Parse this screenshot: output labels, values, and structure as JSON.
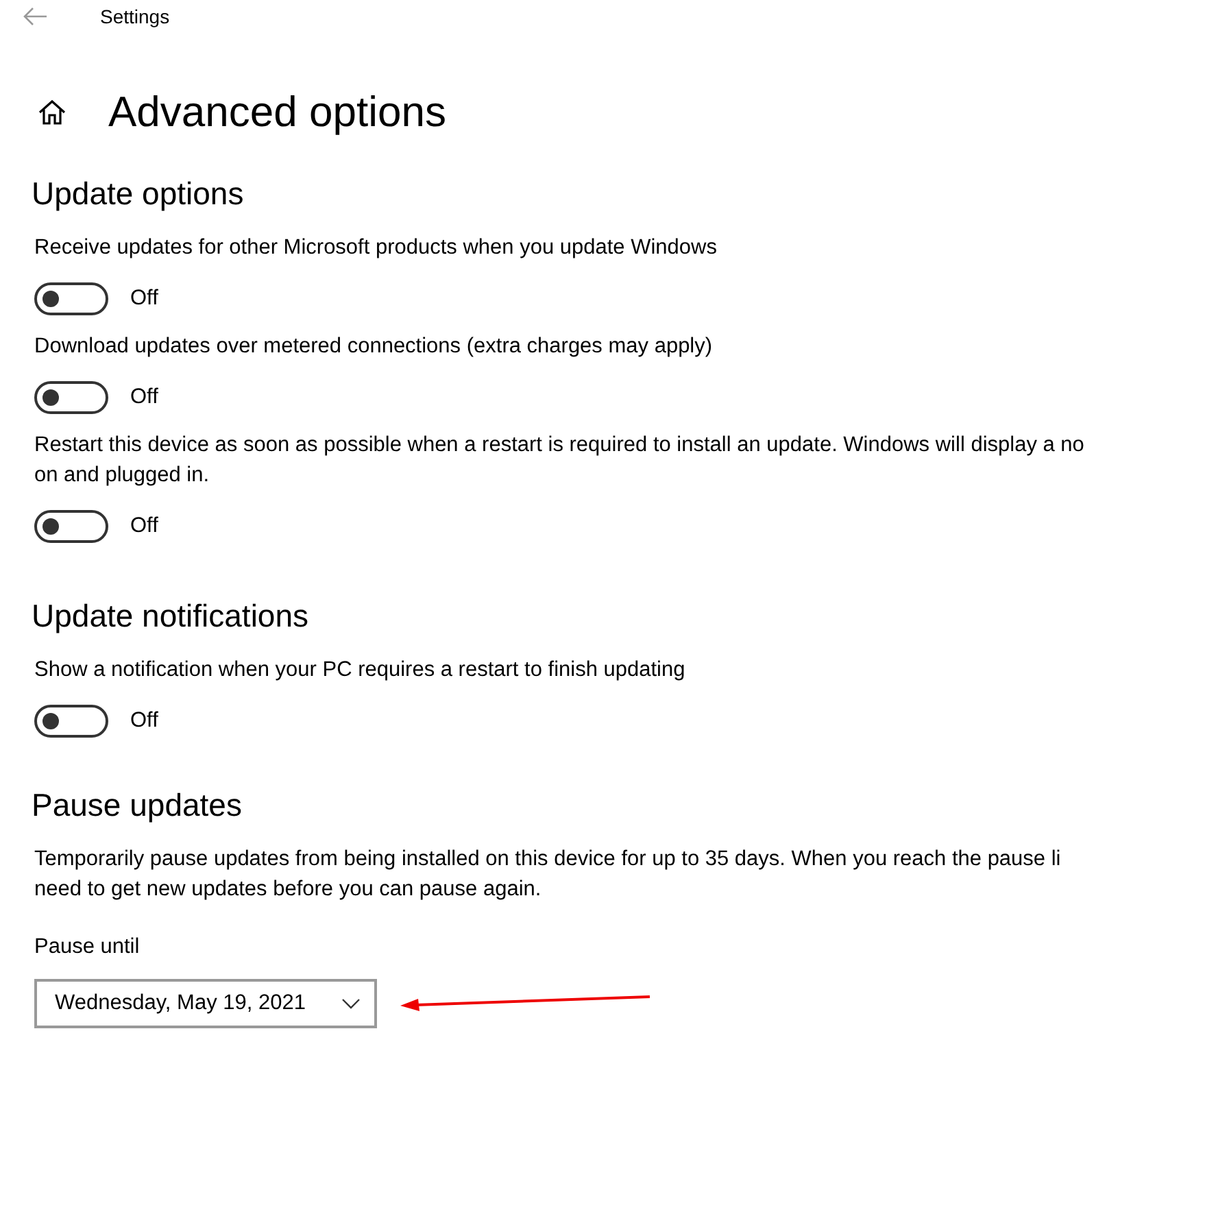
{
  "window": {
    "title": "Settings"
  },
  "page_title": "Advanced options",
  "sections": [
    {
      "heading": "Update options",
      "items": [
        {
          "kind": "toggle",
          "lines": [
            "Receive updates for other Microsoft products when you update Windows"
          ],
          "on": false,
          "state_label": "Off"
        },
        {
          "kind": "toggle",
          "lines": [
            "Download updates over metered connections (extra charges may apply)"
          ],
          "on": false,
          "state_label": "Off"
        },
        {
          "kind": "toggle",
          "lines": [
            "Restart this device as soon as possible when a restart is required to install an update. Windows will display a no",
            "on and plugged in."
          ],
          "on": false,
          "state_label": "Off"
        }
      ]
    },
    {
      "heading": "Update notifications",
      "items": [
        {
          "kind": "toggle",
          "lines": [
            "Show a notification when your PC requires a restart to finish updating"
          ],
          "on": false,
          "state_label": "Off"
        }
      ]
    },
    {
      "heading": "Pause updates",
      "items": [
        {
          "kind": "text",
          "lines": [
            "Temporarily pause updates from being installed on this device for up to 35 days. When you reach the pause li",
            "need to get new updates before you can pause again."
          ]
        },
        {
          "kind": "dropdown",
          "label": "Pause until",
          "value": "Wednesday, May 19, 2021"
        }
      ]
    }
  ]
}
